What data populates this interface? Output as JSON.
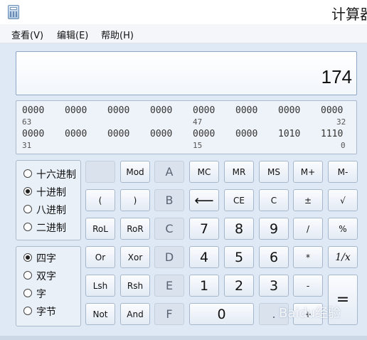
{
  "window": {
    "title": "计算器"
  },
  "menu": {
    "view": "查看(V)",
    "edit": "编辑(E)",
    "help": "帮助(H)"
  },
  "display": {
    "value": "174"
  },
  "bits": {
    "row1": [
      "0000",
      "0000",
      "0000",
      "0000",
      "0000",
      "0000",
      "0000",
      "0000"
    ],
    "row1_positions": {
      "left": "63",
      "mid": "47",
      "right": "32"
    },
    "row2": [
      "0000",
      "0000",
      "0000",
      "0000",
      "0000",
      "0000",
      "1010",
      "1110"
    ],
    "row2_positions": {
      "left": "31",
      "mid": "15",
      "right": "0"
    }
  },
  "radix_options": [
    {
      "label": "十六进制",
      "checked": false
    },
    {
      "label": "十进制",
      "checked": true
    },
    {
      "label": "八进制",
      "checked": false
    },
    {
      "label": "二进制",
      "checked": false
    }
  ],
  "word_options": [
    {
      "label": "四字",
      "checked": true
    },
    {
      "label": "双字",
      "checked": false
    },
    {
      "label": "字",
      "checked": false
    },
    {
      "label": "字节",
      "checked": false
    }
  ],
  "buttons": {
    "blank": "",
    "mod": "Mod",
    "a": "A",
    "mc": "MC",
    "mr": "MR",
    "ms": "MS",
    "mplus": "M+",
    "mminus": "M-",
    "lparen": "(",
    "rparen": ")",
    "b": "B",
    "back": "⟵",
    "ce": "CE",
    "c": "C",
    "neg": "±",
    "sqrt": "√",
    "rol": "RoL",
    "ror": "RoR",
    "cc": "C",
    "n7": "7",
    "n8": "8",
    "n9": "9",
    "div": "/",
    "pct": "%",
    "or": "Or",
    "xor": "Xor",
    "d": "D",
    "n4": "4",
    "n5": "5",
    "n6": "6",
    "mul": "*",
    "recip": "1/x",
    "lsh": "Lsh",
    "rsh": "Rsh",
    "e": "E",
    "n1": "1",
    "n2": "2",
    "n3": "3",
    "sub": "-",
    "eq": "=",
    "not": "Not",
    "and": "And",
    "f": "F",
    "n0": "0",
    "dot": ".",
    "add": "+"
  },
  "watermark": "Baidu经验"
}
